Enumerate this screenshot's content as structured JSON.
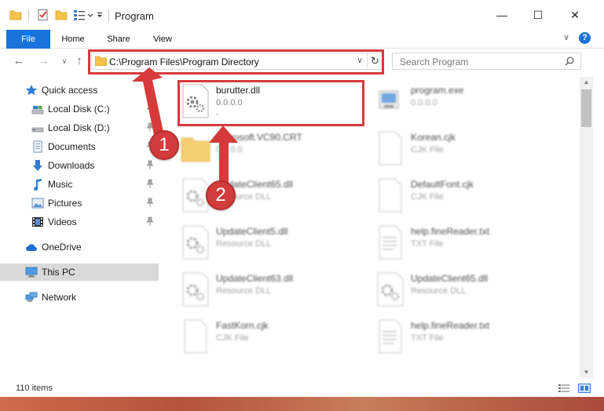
{
  "window": {
    "title": "Program",
    "minimize_glyph": "—",
    "maximize_glyph": "☐",
    "close_glyph": "✕"
  },
  "ribbon": {
    "tabs": [
      {
        "label": "File"
      },
      {
        "label": "Home"
      },
      {
        "label": "Share"
      },
      {
        "label": "View"
      }
    ],
    "expand_glyph": "∨",
    "help_glyph": "?"
  },
  "navigation": {
    "back_glyph": "←",
    "forward_glyph": "→",
    "recent_glyph": "∨",
    "up_glyph": "↑",
    "address_path": "C:\\Program Files\\Program Directory",
    "address_dropdown_glyph": "∨",
    "refresh_glyph": "↻",
    "search_placeholder": "Search Program"
  },
  "sidebar": {
    "items": [
      {
        "label": "Quick access",
        "icon": "star-icon"
      },
      {
        "label": "Local Disk (C:)",
        "icon": "drive-icon",
        "pinned": true
      },
      {
        "label": "Local Disk (D:)",
        "icon": "drive-icon",
        "pinned": true
      },
      {
        "label": "Documents",
        "icon": "documents-icon",
        "pinned": true
      },
      {
        "label": "Downloads",
        "icon": "download-icon",
        "pinned": true
      },
      {
        "label": "Music",
        "icon": "music-icon",
        "pinned": true
      },
      {
        "label": "Pictures",
        "icon": "pictures-icon",
        "pinned": true
      },
      {
        "label": "Videos",
        "icon": "videos-icon",
        "pinned": true
      },
      {
        "label": "OneDrive",
        "icon": "cloud-icon"
      },
      {
        "label": "This PC",
        "icon": "computer-icon",
        "selected": true
      },
      {
        "label": "Network",
        "icon": "network-icon"
      }
    ]
  },
  "files": [
    {
      "name": "burutter.dll",
      "line2": "0.0.0.0",
      "line3": "-",
      "icon": "dll-gear-icon",
      "highlighted": true
    },
    {
      "name": "program.exe",
      "line2": "0.0.0.0",
      "line3": "",
      "icon": "exe-icon"
    },
    {
      "name": "Microsoft.VC90.CRT",
      "line2": "0.0.0.0",
      "line3": "",
      "icon": "folder-icon"
    },
    {
      "name": "Korean.cjk",
      "line2": "CJK File",
      "line3": "",
      "icon": "blank-file-icon"
    },
    {
      "name": "UpdateClient65.dll",
      "line2": "Resource DLL",
      "line3": "",
      "icon": "dll-gear-icon"
    },
    {
      "name": "DefaultFont.cjk",
      "line2": "CJK File",
      "line3": "",
      "icon": "blank-file-icon"
    },
    {
      "name": "UpdateClient5.dll",
      "line2": "Resource DLL",
      "line3": "",
      "icon": "dll-gear-icon"
    },
    {
      "name": "help.fineReader.txt",
      "line2": "TXT File",
      "line3": "",
      "icon": "text-file-icon"
    },
    {
      "name": "UpdateClient63.dll",
      "line2": "Resource DLL",
      "line3": "",
      "icon": "dll-gear-icon"
    },
    {
      "name": "UpdateClient65.dll",
      "line2": "Resource DLL",
      "line3": "",
      "icon": "dll-gear-icon"
    },
    {
      "name": "FastKorn.cjk",
      "line2": "CJK File",
      "line3": "",
      "icon": "blank-file-icon"
    },
    {
      "name": "help.fineReader.txt",
      "line2": "TXT File",
      "line3": "",
      "icon": "text-file-icon"
    }
  ],
  "status": {
    "item_count": "110 items"
  },
  "annotations": {
    "step1": "1",
    "step2": "2",
    "color": "#d63a3a"
  }
}
